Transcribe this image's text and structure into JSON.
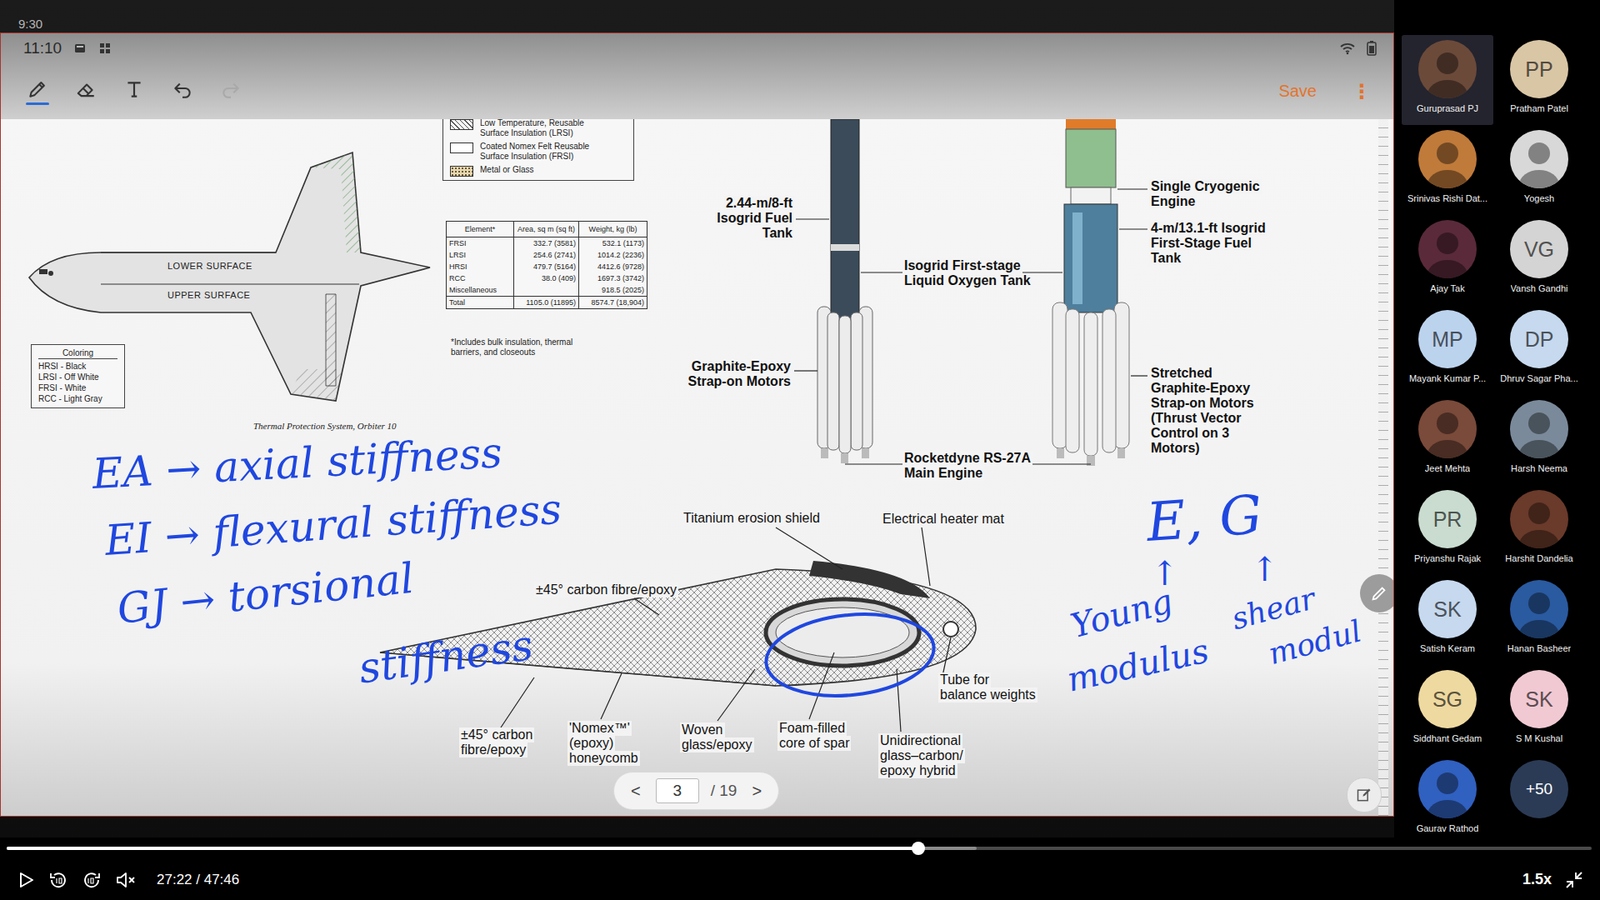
{
  "status": {
    "overlay": "9:30",
    "clock": "11:10"
  },
  "toolbar": {
    "tools": [
      {
        "kind": "pen",
        "selected": true,
        "disabled": false
      },
      {
        "kind": "eraser",
        "selected": false,
        "disabled": false
      },
      {
        "kind": "text",
        "selected": false,
        "disabled": false
      },
      {
        "kind": "undo",
        "selected": false,
        "disabled": false
      },
      {
        "kind": "redo",
        "selected": false,
        "disabled": true
      }
    ],
    "save": "Save",
    "more": "⋮"
  },
  "slide": {
    "insulation_key": [
      {
        "kind": "hatch",
        "lines": [
          "Low Temperature, Reusable",
          "Surface Insulation (LRSI)"
        ]
      },
      {
        "kind": "blank",
        "lines": [
          "Coated Nomex Felt Reusable",
          "Surface Insulation (FRSI)"
        ]
      },
      {
        "kind": "dots",
        "lines": [
          "Metal or Glass"
        ]
      }
    ],
    "area_table": {
      "columns": [
        "Element*",
        "Area, sq m (sq ft)",
        "Weight, kg (lb)"
      ],
      "rows": [
        [
          "FRSI",
          "332.7 (3581)",
          "532.1 (1173)"
        ],
        [
          "LRSI",
          "254.6 (2741)",
          "1014.2 (2236)"
        ],
        [
          "HRSI",
          "479.7 (5164)",
          "4412.6 (9728)"
        ],
        [
          "RCC",
          "38.0 (409)",
          "1697.3 (3742)"
        ],
        [
          "Miscellaneous",
          "",
          "918.5 (2025)"
        ],
        [
          "Total",
          "1105.0 (11895)",
          "8574.7 (18,904)"
        ]
      ],
      "footnote": [
        "*Includes bulk insulation, thermal",
        "barriers, and closeouts"
      ]
    },
    "coloring": [
      "Coloring",
      "HRSI - Black",
      "LRSI - Off White",
      "FRSI - White",
      "RCC - Light Gray"
    ],
    "shuttle_labels": [
      "LOWER SURFACE",
      "UPPER SURFACE"
    ],
    "caption": "Thermal Protection System, Orbiter 10",
    "rocket_labels": [
      [
        "2.44-m/8-ft",
        "Isogrid Fuel",
        "Tank"
      ],
      [
        "Isogrid First-stage",
        "Liquid Oxygen Tank"
      ],
      [
        "Graphite-Epoxy",
        "Strap-on Motors"
      ],
      [
        "Rocketdyne RS-27A",
        "Main Engine"
      ],
      [
        "Single Cryogenic",
        "Engine"
      ],
      [
        "4-m/13.1-ft Isogrid",
        "First-Stage Fuel",
        "Tank"
      ],
      [
        "Stretched",
        "Graphite-Epoxy",
        "Strap-on Motors",
        "(Thrust Vector",
        "Control on 3",
        "Motors)"
      ]
    ],
    "airfoil_labels": [
      [
        "±45° carbon fibre/epoxy"
      ],
      [
        "Titanium erosion shield"
      ],
      [
        "Electrical heater mat"
      ],
      [
        "Tube for",
        "balance weights"
      ],
      [
        "±45° carbon",
        "fibre/epoxy"
      ],
      [
        "'Nomex™'",
        "(epoxy)",
        "honeycomb"
      ],
      [
        "Woven",
        "glass/epoxy"
      ],
      [
        "Foam-filled",
        "core of spar"
      ],
      [
        "Unidirectional",
        "glass–carbon/",
        "epoxy hybrid"
      ]
    ],
    "annotations": [
      "EA → axial stiffness",
      "EI → flexural stiffness",
      "GJ → torsional",
      "stiffness",
      "E, G",
      "↑",
      "↑",
      "Young",
      "modulus",
      "shear",
      "modul"
    ]
  },
  "pager": {
    "prev": "<",
    "page": "3",
    "total": "/ 19",
    "next": ">"
  },
  "participants": [
    {
      "name": "Guruprasad PJ",
      "kind": "photo",
      "initials": "",
      "color": "#6b4a3a",
      "selected": true
    },
    {
      "name": "Pratham Patel",
      "kind": "initials",
      "initials": "PP",
      "color": "#d9c6a5",
      "selected": false
    },
    {
      "name": "Srinivas Rishi Dat...",
      "kind": "photo",
      "initials": "",
      "color": "#c07a3a",
      "selected": false
    },
    {
      "name": "Yogesh",
      "kind": "photo",
      "initials": "",
      "color": "#d8d8d8",
      "selected": false
    },
    {
      "name": "Ajay Tak",
      "kind": "photo",
      "initials": "",
      "color": "#5a2a3a",
      "selected": false
    },
    {
      "name": "Vansh Gandhi",
      "kind": "initials",
      "initials": "VG",
      "color": "#d4d4d4",
      "selected": false
    },
    {
      "name": "Mayank Kumar P...",
      "kind": "initials",
      "initials": "MP",
      "color": "#bcd3ee",
      "selected": false
    },
    {
      "name": "Dhruv Sagar Pha...",
      "kind": "initials",
      "initials": "DP",
      "color": "#c6d9ee",
      "selected": false
    },
    {
      "name": "Jeet Mehta",
      "kind": "photo",
      "initials": "",
      "color": "#7a4a3a",
      "selected": false
    },
    {
      "name": "Harsh Neema",
      "kind": "photo",
      "initials": "",
      "color": "#7a8a9a",
      "selected": false
    },
    {
      "name": "Priyanshu Rajak",
      "kind": "initials",
      "initials": "PR",
      "color": "#c9dccf",
      "selected": false
    },
    {
      "name": "Harshit Dandelia",
      "kind": "photo",
      "initials": "",
      "color": "#6a3a2a",
      "selected": false
    },
    {
      "name": "Satish Keram",
      "kind": "initials",
      "initials": "SK",
      "color": "#c6d9ee",
      "selected": false
    },
    {
      "name": "Hanan Basheer",
      "kind": "photo",
      "initials": "",
      "color": "#2a5aa0",
      "selected": false
    },
    {
      "name": "Siddhant Gedam",
      "kind": "initials",
      "initials": "SG",
      "color": "#eed9a0",
      "selected": false
    },
    {
      "name": "S M Kushal",
      "kind": "initials",
      "initials": "SK",
      "color": "#f1c9d3",
      "selected": false
    },
    {
      "name": "Gaurav Rathod",
      "kind": "photo",
      "initials": "",
      "color": "#3060c0",
      "selected": false
    }
  ],
  "more_participants": "+50",
  "player": {
    "playing": false,
    "muted": true,
    "time": "27:22 / 47:46",
    "played": 0.575,
    "buffered": 0.612,
    "speed": "1.5x"
  }
}
